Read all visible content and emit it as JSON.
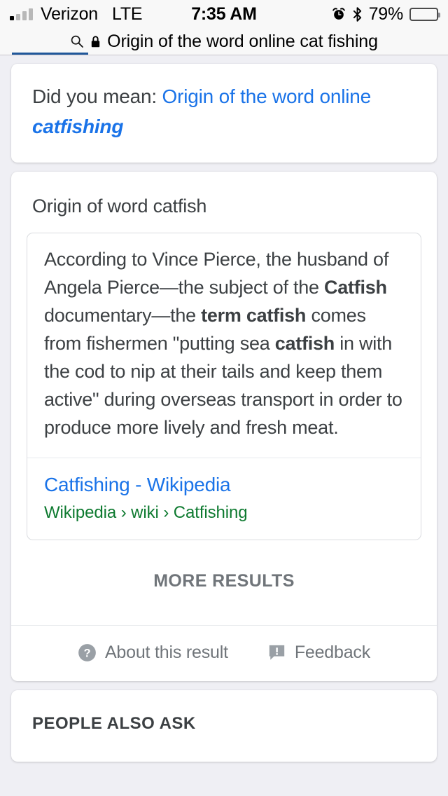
{
  "statusbar": {
    "carrier": "Verizon",
    "network": "LTE",
    "time": "7:35 AM",
    "battery_percent": "79%",
    "signal_bars_filled": 1,
    "signal_bars_total": 4,
    "icons": [
      "alarm-clock-icon",
      "bluetooth-icon",
      "battery-icon"
    ]
  },
  "urlbar": {
    "query": "Origin of the word online cat fishing",
    "search_icon": "search-icon",
    "lock_icon": "lock-icon",
    "loading_progress_percent": 17
  },
  "did_you_mean": {
    "prefix": "Did you mean: ",
    "suggestion_plain": "Origin of the word online ",
    "suggestion_emphasis": "catfishing",
    "link_color": "#1a73e8"
  },
  "answer_card": {
    "title": "Origin of word catfish",
    "snippet_parts": [
      {
        "text": "According to Vince Pierce, the husband of Angela Pierce",
        "bold": false
      },
      {
        "text": "—the subject of the ",
        "bold": false
      },
      {
        "text": "Catfish",
        "bold": true
      },
      {
        "text": " documentary—the ",
        "bold": false
      },
      {
        "text": "term catfish",
        "bold": true
      },
      {
        "text": " comes from fishermen \"putting sea ",
        "bold": false
      },
      {
        "text": "catfish",
        "bold": true
      },
      {
        "text": " in with the cod to nip at their tails and keep them active\" during overseas transport in order to produce more lively and fresh meat.",
        "bold": false
      }
    ],
    "source_title": "Catfishing - Wikipedia",
    "source_breadcrumb": "Wikipedia › wiki › Catfishing",
    "source_title_color": "#1a73e8",
    "source_breadcrumb_color": "#0e7a30",
    "more_results_label": "MORE RESULTS",
    "footer": {
      "about_label": "About this result",
      "about_icon": "question-mark-circle-icon",
      "feedback_label": "Feedback",
      "feedback_icon": "feedback-bubble-icon"
    }
  },
  "people_also_ask": {
    "title": "PEOPLE ALSO ASK"
  }
}
